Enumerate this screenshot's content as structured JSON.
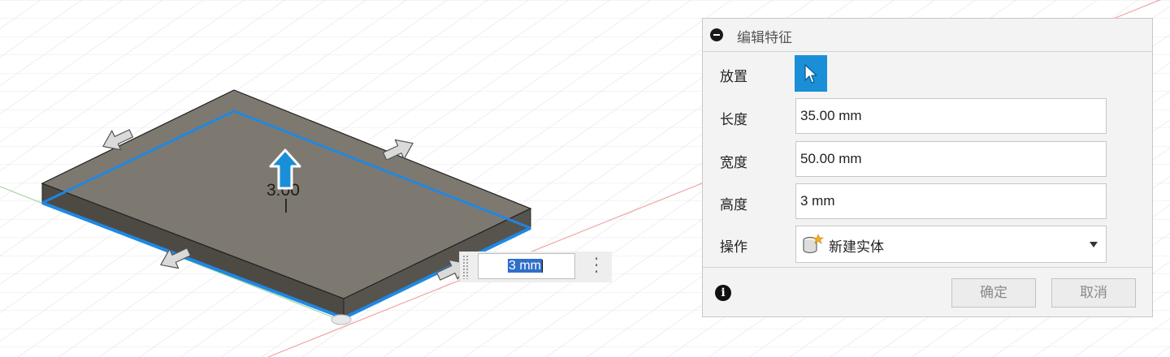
{
  "viewport": {
    "box_dimension_label": "3.00",
    "inline_input": {
      "value": "3 mm"
    }
  },
  "dialog": {
    "title": "编辑特征",
    "rows": {
      "placement": {
        "label": "放置"
      },
      "length": {
        "label": "长度",
        "value": "35.00 mm"
      },
      "width": {
        "label": "宽度",
        "value": "50.00 mm"
      },
      "height": {
        "label": "高度",
        "value": "3 mm"
      },
      "operation": {
        "label": "操作",
        "value": "新建实体"
      }
    },
    "ok_label": "确定",
    "cancel_label": "取消"
  },
  "colors": {
    "accent": "#1a8fd8",
    "edge_highlight": "#1e88e5",
    "box_top": "#7d7970",
    "grid": "#e3e3e3"
  }
}
